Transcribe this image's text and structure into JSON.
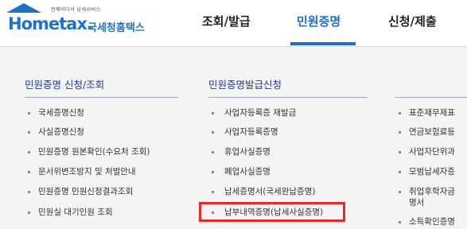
{
  "logo": {
    "tagline": "언제어디서  납세서비스",
    "brand": "Hometax.",
    "subtitle": "국세청홈택스"
  },
  "nav": {
    "items": [
      {
        "label": "조회/발급"
      },
      {
        "label": "민원증명"
      },
      {
        "label": "신청/제출"
      }
    ]
  },
  "columns": {
    "col1": {
      "title": "민원증명 신청/조회",
      "items": [
        "국세증명신청",
        "사실증명신청",
        "민원증명 원본확인(수요처 조회)",
        "문서위변조방지 및 처벌안내",
        "민원증명 민원신청결과조회",
        "민원실 대기인원 조회"
      ]
    },
    "col2": {
      "title": "민원증명발급신청",
      "items": [
        "사업자등록증 재발급",
        "사업자등록증명",
        "휴업사실증명",
        "폐업사실증명",
        "납세증명서(국세완납증명)",
        "납부내역증명(납세사실증명)"
      ]
    },
    "col3": {
      "items": [
        "표준재무제표",
        "연금보험료등",
        "사업자단위과",
        "모범납세자증",
        "취업후학자금",
        "명서",
        "소득확인증명"
      ]
    }
  }
}
